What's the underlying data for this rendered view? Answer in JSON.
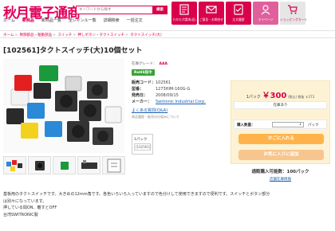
{
  "header": {
    "logo": "秋月電子通商",
    "search_placeholder": "キーワードから探す",
    "search_button": "検索",
    "nav": [
      "ホーム",
      "新商品",
      "新商品一覧",
      "全ジャンル一覧",
      "詳細検索",
      "一括注文"
    ],
    "active_nav_index": 1,
    "icon_buttons": [
      {
        "label": "カタログ請求(旧)",
        "icon": "catalog-icon",
        "style": "red"
      },
      {
        "label": "ご意見・お問合せ",
        "icon": "mail-icon",
        "style": "red"
      },
      {
        "label": "注文履歴",
        "icon": "history-icon",
        "style": "red"
      },
      {
        "label": "マイページ",
        "icon": "user-icon",
        "style": "pink"
      },
      {
        "label": "ショッピングカート",
        "icon": "cart-icon",
        "style": "gray"
      }
    ]
  },
  "breadcrumbs": [
    "ホーム",
    "制御部品・駆動部品",
    "スイッチ",
    "押しボタン・タクトスイッチ",
    "タクトスイッチ(大)"
  ],
  "product": {
    "title": "[102561]タクトスイッチ(大)10個セット",
    "grade_label": "在庫グレード：",
    "grade_value": "AAA",
    "rohs": "RoHS指令",
    "specs": [
      {
        "label": "販売コード：",
        "value": "102561",
        "link": false
      },
      {
        "label": "型番：",
        "value": "1273HIM-160G-G",
        "link": false
      },
      {
        "label": "発売日：",
        "value": "2008/09/15",
        "link": false
      },
      {
        "label": "メーカー：",
        "value": "Switronic Industrial Corp.",
        "link": true
      }
    ],
    "qa_link": "よくある質問(Q&A)",
    "note": "商品履歴・販売の仕組みについて",
    "pack_label": "1パック",
    "pack_code": "[102561]"
  },
  "cart": {
    "unit": "1パック",
    "price": "￥300",
    "tax_note": "(税込) 税抜 ￥273",
    "stock": "在庫あり",
    "qty_label": "購入数量：",
    "qty_value": "1",
    "qty_unit": "パック",
    "add_button": "かごに入れる",
    "fav_button": "お気に入りに追加",
    "mail_order": "通販購入可能数：100パック",
    "store_link": "店舗在庫情報"
  },
  "description": [
    "基板用のタクトスイッチです。大きめの12mm角です。各色いろいろ入っていますので色分けして使用できますので便利です。スイッチとボタン部分",
    "は別々になっています。",
    "押している間ON、離すとOFF",
    "台湾SWITRONIC製"
  ],
  "colors": {
    "brand": "#d9004c",
    "cart_bg": "#fdf3d4",
    "add_button": "#ffb34a",
    "fav_button": "#f7c68e",
    "rohs": "#3aa23a"
  }
}
